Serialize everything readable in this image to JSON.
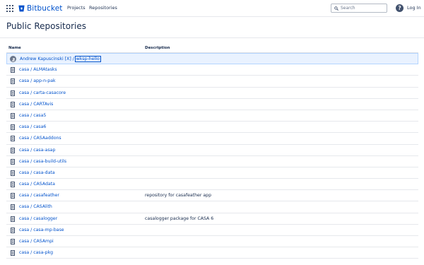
{
  "header": {
    "logo_text": "Bitbucket",
    "nav": [
      "Projects",
      "Repositories"
    ],
    "search_placeholder": "Search",
    "help_symbol": "?",
    "login_label": "Log In"
  },
  "page": {
    "title": "Public Repositories"
  },
  "table": {
    "columns": {
      "name": "Name",
      "description": "Description"
    },
    "highlight_row": {
      "user": "Andrew Kapuscinski [X]",
      "separator": " / ",
      "repo": "wksp-hello"
    },
    "rows": [
      {
        "name": "casa / ALMAtasks",
        "description": ""
      },
      {
        "name": "casa / app-n-pak",
        "description": ""
      },
      {
        "name": "casa / carta-casacore",
        "description": ""
      },
      {
        "name": "casa / CARTAvis",
        "description": ""
      },
      {
        "name": "casa / casa5",
        "description": ""
      },
      {
        "name": "casa / casa6",
        "description": ""
      },
      {
        "name": "casa / CASAaddons",
        "description": ""
      },
      {
        "name": "casa / casa-asap",
        "description": ""
      },
      {
        "name": "casa / casa-build-utils",
        "description": ""
      },
      {
        "name": "casa / casa-data",
        "description": ""
      },
      {
        "name": "casa / CASAdata",
        "description": ""
      },
      {
        "name": "casa / casafeather",
        "description": "repository for casafeather app"
      },
      {
        "name": "casa / CASAlith",
        "description": ""
      },
      {
        "name": "casa / casalogger",
        "description": "casalogger package for CASA 6"
      },
      {
        "name": "casa / casa-mp-base",
        "description": ""
      },
      {
        "name": "casa / CASAmpi",
        "description": ""
      },
      {
        "name": "casa / casa-pkg",
        "description": ""
      }
    ]
  },
  "colors": {
    "link": "#0052cc",
    "brand": "#0052cc",
    "highlight_bg": "#e9f2ff",
    "text": "#172b4d"
  },
  "icons": {
    "app_switcher": "grid-icon",
    "logo": "bitbucket-logo-icon",
    "search": "search-icon",
    "help": "help-icon",
    "repo": "repository-icon",
    "avatar": "avatar-icon"
  }
}
